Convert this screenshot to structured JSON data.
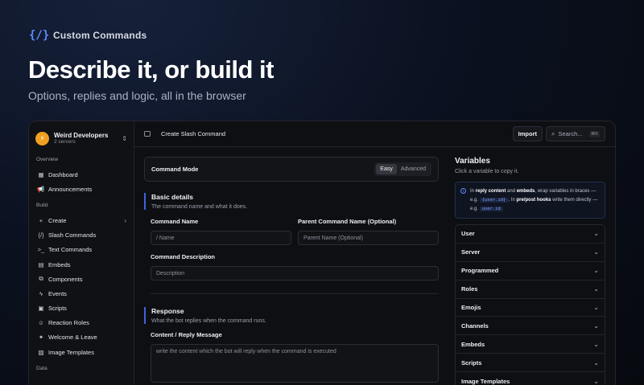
{
  "hero": {
    "tag_icon": "{/}",
    "tag_label": "Custom Commands",
    "title": "Describe it, or build it",
    "subtitle": "Options, replies and logic, all in the browser"
  },
  "workspace": {
    "name": "Weird Developers",
    "sub": "2 servers"
  },
  "sidebar": {
    "sections": [
      {
        "label": "Overview",
        "items": [
          {
            "icon": "▦",
            "label": "Dashboard"
          },
          {
            "icon": "📢",
            "label": "Announcements"
          }
        ]
      },
      {
        "label": "Build",
        "items": [
          {
            "icon": "+",
            "label": "Create",
            "trail": "›"
          },
          {
            "icon": "{/}",
            "label": "Slash Commands"
          },
          {
            "icon": ">_",
            "label": "Text Commands"
          },
          {
            "icon": "▤",
            "label": "Embeds"
          },
          {
            "icon": "⧉",
            "label": "Components"
          },
          {
            "icon": "ϟ",
            "label": "Events"
          },
          {
            "icon": "▣",
            "label": "Scripts"
          },
          {
            "icon": "☺",
            "label": "Reaction Roles"
          },
          {
            "icon": "✦",
            "label": "Welcome & Leave"
          },
          {
            "icon": "▨",
            "label": "Image Templates"
          }
        ]
      },
      {
        "label": "Data",
        "items": []
      }
    ]
  },
  "topbar": {
    "page_title": "Create Slash Command",
    "import_label": "Import",
    "search_placeholder": "Search...",
    "search_kbd": "⌘K"
  },
  "form": {
    "mode_label": "Command Mode",
    "mode_easy": "Easy",
    "mode_advanced": "Advanced",
    "basic": {
      "title": "Basic details",
      "desc": "The command name and what it does.",
      "name_label": "Command Name",
      "name_placeholder": "/ Name",
      "parent_label": "Parent Command Name (Optional)",
      "parent_placeholder": "Parent Name (Optional)",
      "desc_label": "Command Description",
      "desc_placeholder": "Description"
    },
    "response": {
      "title": "Response",
      "desc": "What the bot replies when the command runs.",
      "content_label": "Content / Reply Message",
      "content_placeholder": "write the content which the bot will reply when the command is executed"
    }
  },
  "variables": {
    "title": "Variables",
    "desc": "Click a variable to copy it.",
    "info": {
      "t1": "In ",
      "b1": "reply content",
      "t2": " and ",
      "b2": "embeds",
      "t3": ", wrap variables in braces — e.g. ",
      "c1": "{user.id}",
      "t4": ". In ",
      "b3": "pre/post hooks",
      "t5": " write them directly — e.g. ",
      "c2": "user.id"
    },
    "groups": [
      "User",
      "Server",
      "Programmed",
      "Roles",
      "Emojis",
      "Channels",
      "Embeds",
      "Scripts",
      "Image Templates"
    ]
  }
}
